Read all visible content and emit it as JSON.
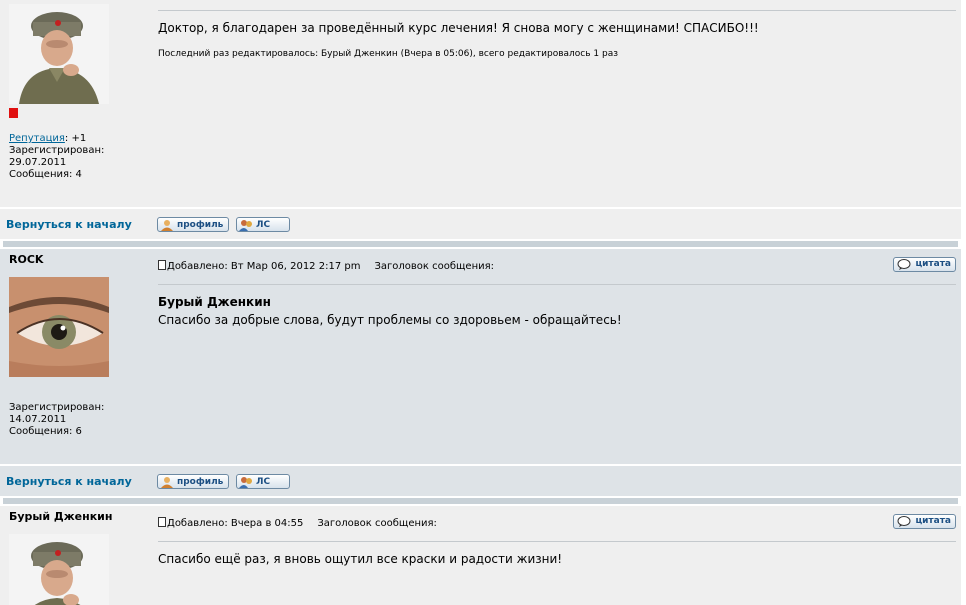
{
  "posts": [
    {
      "details": {
        "rep_label": "Репутация",
        "rep_value": ": +1",
        "registered_label": "Зарегистрирован:",
        "registered_date": "29.07.2011",
        "messages": "Сообщения: 4"
      },
      "body": "Доктор, я благодарен за проведённый курс лечения! Я снова могу с женщинами! СПАСИБО!!!",
      "edited": "Последний раз редактировалось: Бурый Дженкин (Вчера в 05:06), всего редактировалось 1 раз",
      "back_label": "Вернуться к началу",
      "profile_label": "профиль",
      "pm_label": "ЛС"
    },
    {
      "author": "ROCK",
      "added": "Добавлено: Вт Мар 06, 2012 2:17 pm",
      "subject_label": "Заголовок сообщения:",
      "quote_label": "цитата",
      "quoted_author": "Бурый Дженкин",
      "body": "Спасибо за добрые слова, будут проблемы со здоровьем - обращайтесь!",
      "details": {
        "registered_label": "Зарегистрирован:",
        "registered_date": "14.07.2011",
        "messages": "Сообщения: 6"
      },
      "back_label": "Вернуться к началу",
      "profile_label": "профиль",
      "pm_label": "ЛС"
    },
    {
      "author": "Бурый Дженкин",
      "added": "Добавлено: Вчера в 04:55",
      "subject_label": "Заголовок сообщения:",
      "quote_label": "цитата",
      "body": "Спасибо ещё раз, я вновь ощутил все краски и радости жизни!"
    }
  ],
  "colors": {
    "link": "#006699",
    "row_light": "#efefef",
    "row_dark": "#dee3e7",
    "separator": "#c8d1d7",
    "reputation": "#e01010"
  },
  "icons": [
    "soldier-avatar",
    "eye-avatar",
    "post-icon",
    "profile-icon",
    "pm-icon",
    "quote-icon"
  ]
}
